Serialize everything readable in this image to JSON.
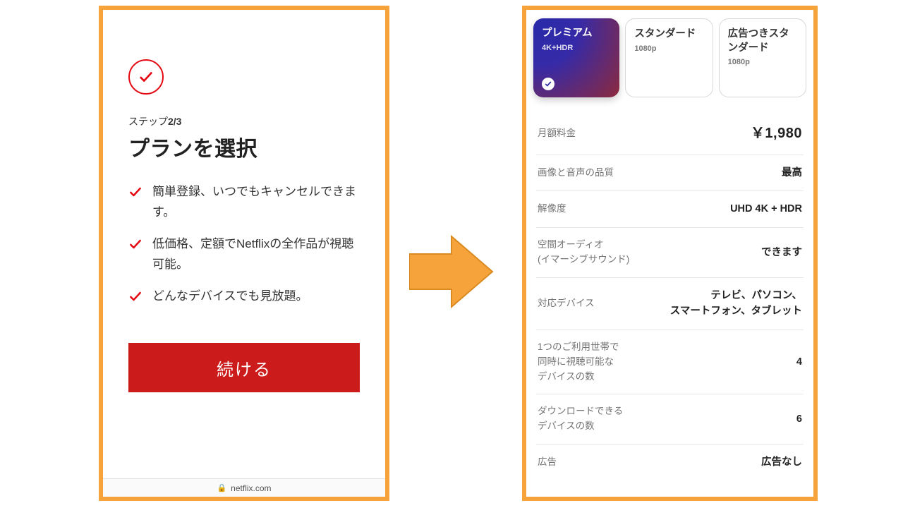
{
  "left": {
    "step_prefix": "ステップ",
    "step_value": "2/3",
    "title": "プランを選択",
    "benefits": [
      "簡単登録、いつでもキャンセルできます。",
      "低価格、定額でNetflixの全作品が視聴可能。",
      "どんなデバイスでも見放題。"
    ],
    "cta": "続ける",
    "url": "netflix.com"
  },
  "right": {
    "tabs": [
      {
        "title": "プレミアム",
        "subtitle": "4K+HDR",
        "selected": true
      },
      {
        "title": "スタンダード",
        "subtitle": "1080p",
        "selected": false
      },
      {
        "title": "広告つきスタンダード",
        "subtitle": "1080p",
        "selected": false
      }
    ],
    "rows": [
      {
        "label": "月額料金",
        "value": "￥1,980",
        "big": true
      },
      {
        "label": "画像と音声の品質",
        "value": "最高"
      },
      {
        "label": "解像度",
        "value": "UHD 4K + HDR"
      },
      {
        "label": "空間オーディオ\n(イマーシブサウンド)",
        "value": "できます"
      },
      {
        "label": "対応デバイス",
        "value": "テレビ、パソコン、\nスマートフォン、タブレット"
      },
      {
        "label": "1つのご利用世帯で\n同時に視聴可能な\nデバイスの数",
        "value": "4"
      },
      {
        "label": "ダウンロードできる\nデバイスの数",
        "value": "6"
      },
      {
        "label": "広告",
        "value": "広告なし"
      }
    ]
  },
  "colors": {
    "accent_red": "#e50914",
    "arrow": "#f5a33a"
  }
}
